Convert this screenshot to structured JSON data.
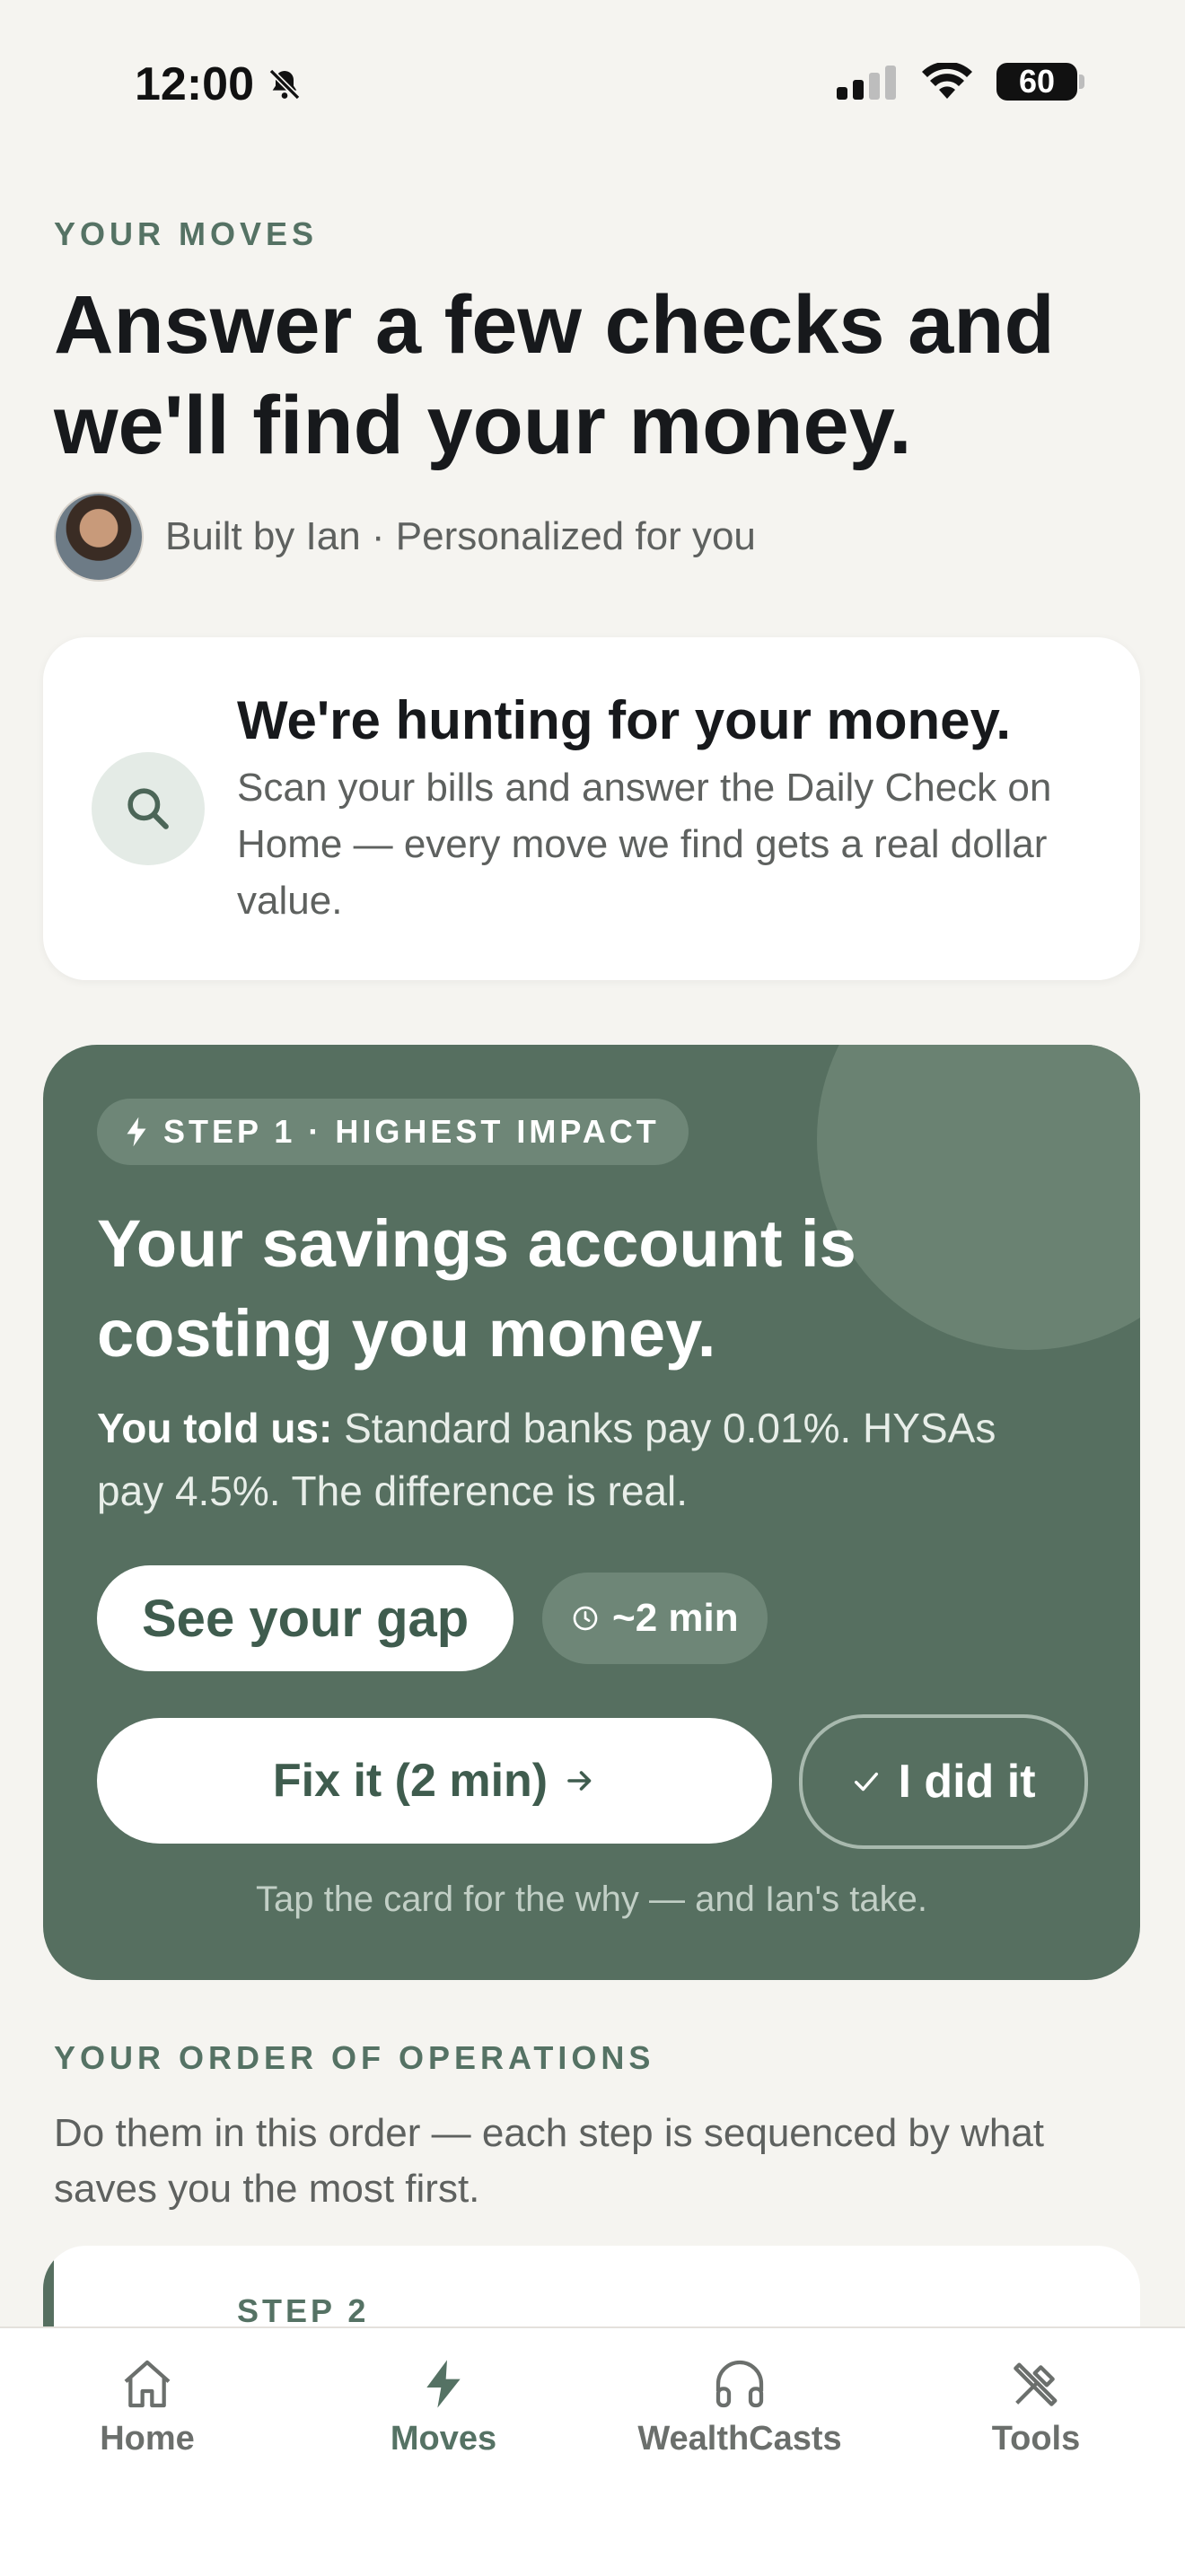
{
  "status_bar": {
    "time": "12:00",
    "battery": "60",
    "icons": [
      "bell-slash-icon",
      "signal-icon",
      "wifi-icon",
      "battery-icon"
    ]
  },
  "header": {
    "eyebrow": "YOUR MOVES",
    "title": "Answer a few checks and we'll find your money.",
    "byline": "Built by Ian · Personalized for you"
  },
  "hunt_card": {
    "title": "We're hunting for your money.",
    "body": "Scan your bills and answer the Daily Check on Home — every move we find gets a real dollar value.",
    "icon": "search-icon"
  },
  "step_card": {
    "pill": "STEP 1 · HIGHEST IMPACT",
    "title": "Your savings account is costing you money.",
    "desc_lead": "You told us:",
    "desc_rest": " Standard banks pay 0.01%. HYSAs pay 4.5%. The difference is real.",
    "gap_button": "See your gap",
    "time_chip": "~2 min",
    "fix_button": "Fix it (2 min)",
    "did_button": "I did it",
    "hint": "Tap the card for the why — and Ian's take."
  },
  "order": {
    "eyebrow": "YOUR ORDER OF OPERATIONS",
    "desc": "Do them in this order — each step is sequenced by what saves you the most first.",
    "next_step_label": "STEP 2"
  },
  "tabs": [
    {
      "label": "Home",
      "icon": "home-icon",
      "active": false
    },
    {
      "label": "Moves",
      "icon": "bolt-icon",
      "active": true
    },
    {
      "label": "WealthCasts",
      "icon": "headphones-icon",
      "active": false
    },
    {
      "label": "Tools",
      "icon": "tools-icon",
      "active": false
    }
  ],
  "colors": {
    "accent": "#566f60",
    "background": "#f5f4f0",
    "card": "#ffffff"
  }
}
